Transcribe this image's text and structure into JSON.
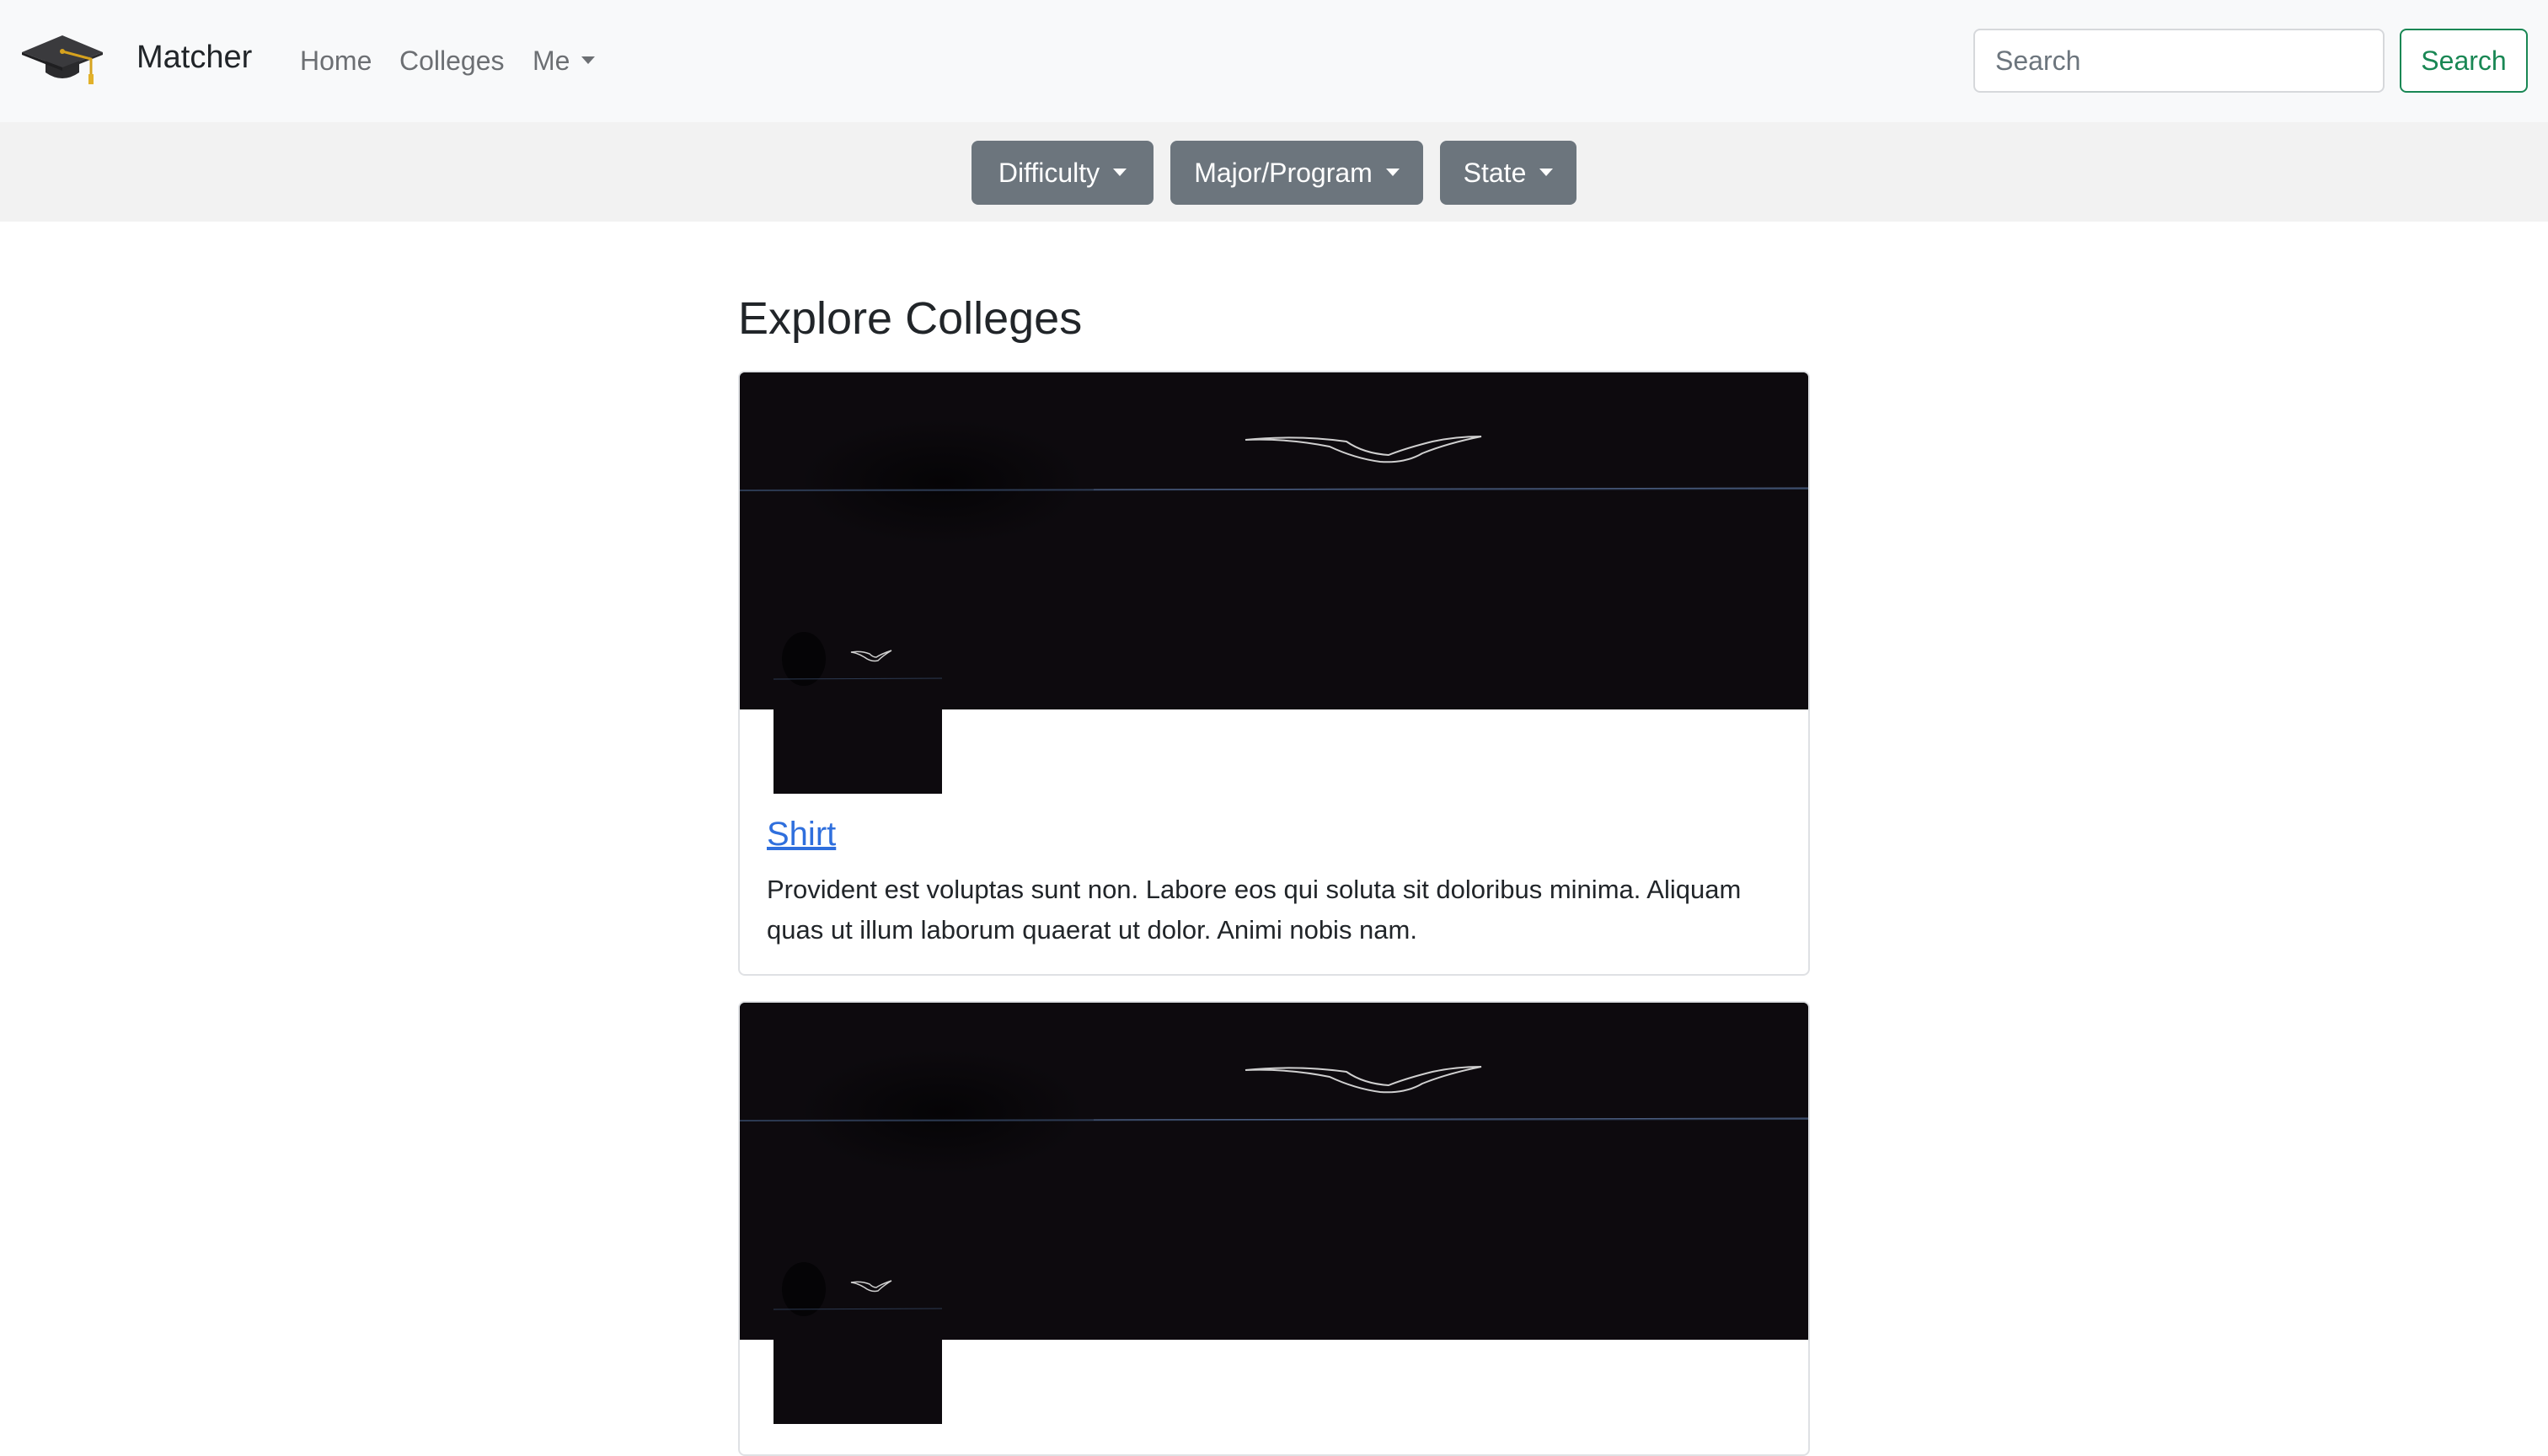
{
  "navbar": {
    "logo_icon": "graduation-cap-icon",
    "brand": "Matcher",
    "links": [
      {
        "label": "Home"
      },
      {
        "label": "Colleges"
      },
      {
        "label": "Me",
        "icon": "caret-down-icon"
      }
    ],
    "search": {
      "placeholder": "Search",
      "value": "",
      "button_label": "Search"
    }
  },
  "filters": [
    {
      "label": "Difficulty",
      "icon": "caret-down-icon"
    },
    {
      "label": "Major/Program",
      "icon": "caret-down-icon"
    },
    {
      "label": "State",
      "icon": "caret-down-icon"
    }
  ],
  "main": {
    "title": "Explore Colleges",
    "cards": [
      {
        "title": "Shirt",
        "description": "Provident est voluptas sunt non. Labore eos qui soluta sit doloribus minima. Aliquam quas ut illum laborum quaerat ut dolor. Animi nobis nam."
      },
      {
        "title": "",
        "description": ""
      }
    ]
  },
  "colors": {
    "navbar_bg": "#f8f9fa",
    "filter_bar_bg": "#f2f2f2",
    "filter_button_bg": "#6c757d",
    "search_button": "#198754",
    "link": "#2f6fdd",
    "image_bg": "#0d0a0e"
  }
}
